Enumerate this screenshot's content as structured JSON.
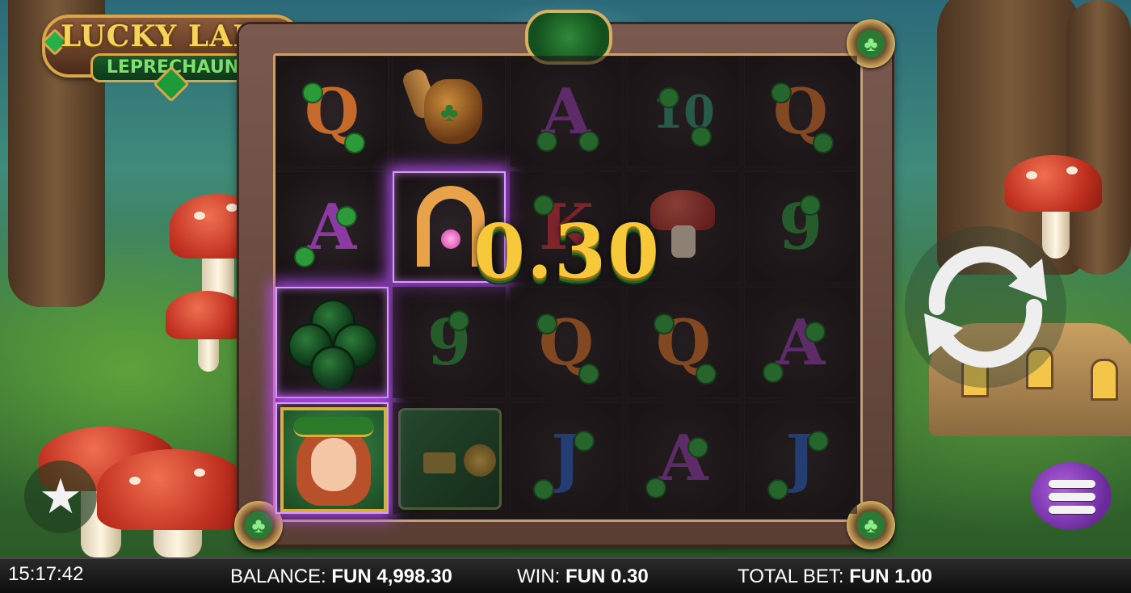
{
  "game": {
    "logo_title": "LUCKY LADY",
    "logo_subtitle": "LEPRECHAUN"
  },
  "win_overlay": {
    "amount": "0.30"
  },
  "reels": [
    [
      "Q",
      "A",
      "clover",
      "lady"
    ],
    [
      "pot-of-gold",
      "horseshoe",
      "9",
      "vault"
    ],
    [
      "A",
      "K",
      "Q",
      "J"
    ],
    [
      "10",
      "mushroom",
      "Q",
      "A"
    ],
    [
      "Q",
      "9",
      "A",
      "J"
    ]
  ],
  "highlighted_symbols": [
    "horseshoe",
    "clover",
    "lady"
  ],
  "controls": {
    "spin_icon": "refresh-arrows-icon",
    "menu_icon": "hamburger-menu-icon",
    "favorite_icon": "star-icon"
  },
  "status_bar": {
    "clock": "15:17:42",
    "balance_label": "BALANCE:",
    "balance_value": "FUN 4,998.30",
    "win_label": "WIN:",
    "win_value": "FUN 0.30",
    "bet_label": "TOTAL BET:",
    "bet_value": "FUN 1.00"
  },
  "colors": {
    "gold": "#f6c83a",
    "win_glow": "#be50ff",
    "frame": "#5a3e34"
  }
}
